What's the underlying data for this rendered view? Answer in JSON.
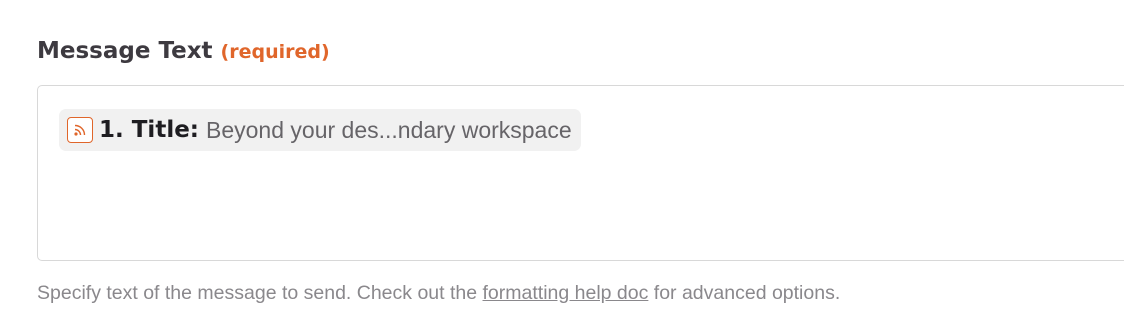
{
  "field": {
    "label": "Message Text",
    "required_tag": "(required)",
    "help_before": "Specify text of the message to send. Check out the ",
    "help_link": "formatting help doc",
    "help_after": " for advanced options."
  },
  "pill": {
    "icon": "rss-icon",
    "key": "1. Title:",
    "value": "Beyond your des...ndary workspace"
  },
  "colors": {
    "accent": "#e0662b",
    "label": "#3d3a40",
    "pill_bg": "#f1f1f1",
    "help_text": "#8a888c",
    "border": "#d8d8d8"
  }
}
